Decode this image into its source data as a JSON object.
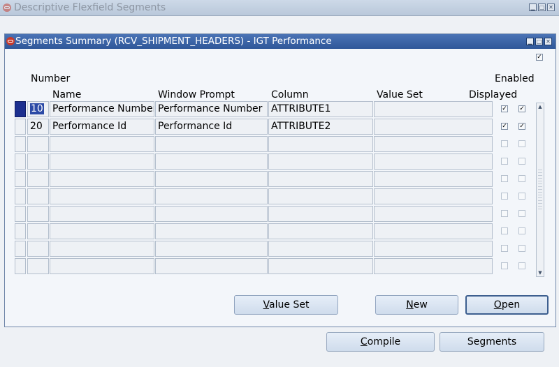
{
  "background_window": {
    "title": "Descriptive Flexfield Segments",
    "buttons": {
      "compile": {
        "pre": "",
        "key": "C",
        "post": "ompile"
      },
      "segments": {
        "pre": "Se",
        "key": "g",
        "post": "ments"
      }
    }
  },
  "dialog": {
    "title": "Segments Summary (RCV_SHIPMENT_HEADERS) - IGT Performance",
    "headers": {
      "number": "Number",
      "name": "Name",
      "window_prompt": "Window Prompt",
      "column": "Column",
      "value_set": "Value Set",
      "enabled": "Enabled",
      "displayed": "Displayed"
    },
    "rows": [
      {
        "number": "10",
        "name": "Performance Number",
        "window_prompt": "Performance Number",
        "column": "ATTRIBUTE1",
        "value_set": "",
        "displayed": true,
        "enabled": true
      },
      {
        "number": "20",
        "name": "Performance Id",
        "window_prompt": "Performance Id",
        "column": "ATTRIBUTE2",
        "value_set": "",
        "displayed": true,
        "enabled": true
      },
      {
        "number": "",
        "name": "",
        "window_prompt": "",
        "column": "",
        "value_set": "",
        "displayed": false,
        "enabled": false
      },
      {
        "number": "",
        "name": "",
        "window_prompt": "",
        "column": "",
        "value_set": "",
        "displayed": false,
        "enabled": false
      },
      {
        "number": "",
        "name": "",
        "window_prompt": "",
        "column": "",
        "value_set": "",
        "displayed": false,
        "enabled": false
      },
      {
        "number": "",
        "name": "",
        "window_prompt": "",
        "column": "",
        "value_set": "",
        "displayed": false,
        "enabled": false
      },
      {
        "number": "",
        "name": "",
        "window_prompt": "",
        "column": "",
        "value_set": "",
        "displayed": false,
        "enabled": false
      },
      {
        "number": "",
        "name": "",
        "window_prompt": "",
        "column": "",
        "value_set": "",
        "displayed": false,
        "enabled": false
      },
      {
        "number": "",
        "name": "",
        "window_prompt": "",
        "column": "",
        "value_set": "",
        "displayed": false,
        "enabled": false
      },
      {
        "number": "",
        "name": "",
        "window_prompt": "",
        "column": "",
        "value_set": "",
        "displayed": false,
        "enabled": false
      }
    ],
    "top_checkbox_checked": true,
    "buttons": {
      "value_set": {
        "pre": "",
        "key": "V",
        "post": "alue Set"
      },
      "new": {
        "pre": "",
        "key": "N",
        "post": "ew"
      },
      "open": {
        "pre": "",
        "key": "O",
        "post": "pen"
      }
    },
    "check_mark": "✓"
  }
}
